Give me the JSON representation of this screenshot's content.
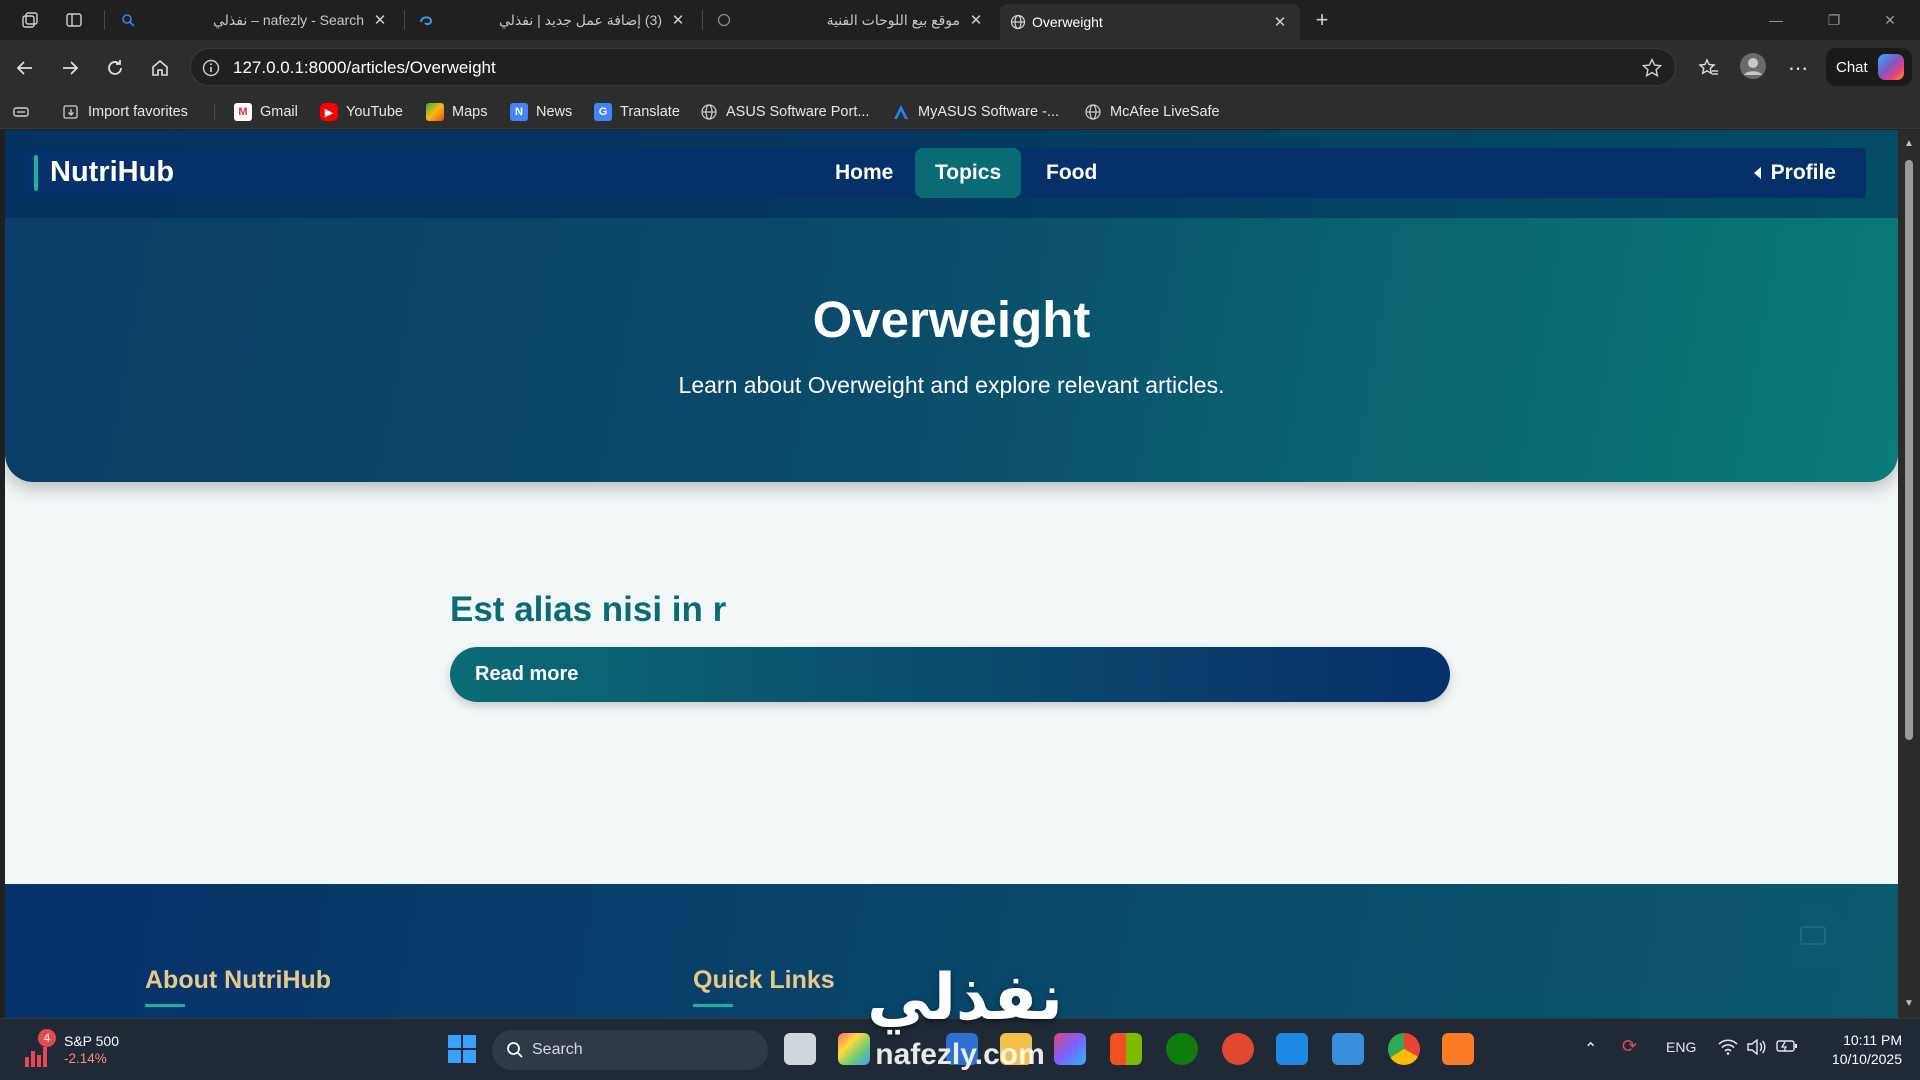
{
  "browser": {
    "tabs": [
      {
        "title": "nafezly - Search – نفذلي",
        "active": false
      },
      {
        "title": "(3) إضافة عمل جديد | نفذلي",
        "active": false
      },
      {
        "title": "موقع بيع اللوحات الفنية",
        "active": false
      },
      {
        "title": "Overweight",
        "active": true
      }
    ],
    "url": "127.0.0.1:8000/articles/Overweight",
    "chat_label": "Chat",
    "bookmarks": [
      "Import favorites",
      "Gmail",
      "YouTube",
      "Maps",
      "News",
      "Translate",
      "ASUS Software Port...",
      "MyASUS Software -...",
      "McAfee LiveSafe"
    ]
  },
  "site": {
    "brand": "NutriHub",
    "nav": [
      {
        "label": "Home",
        "active": false
      },
      {
        "label": "Topics",
        "active": true
      },
      {
        "label": "Food",
        "active": false
      }
    ],
    "profile_label": "Profile",
    "hero": {
      "title": "Overweight",
      "subtitle": "Learn about Overweight and explore relevant articles."
    },
    "articles": [
      {
        "title": "Est alias nisi in r",
        "button": "Read more"
      }
    ],
    "footer": {
      "about_heading": "About NutriHub",
      "links_heading": "Quick Links"
    }
  },
  "watermark": {
    "arabic": "نفذلي",
    "latin": "nafezly.com"
  },
  "taskbar": {
    "stock": {
      "name": "S&P 500",
      "change": "-2.14%",
      "badge": "4"
    },
    "search_label": "Search",
    "language": "ENG",
    "time": "10:11 PM",
    "date": "10/10/2025"
  },
  "colors": {
    "brand_teal": "#0b6b74",
    "brand_navy": "#06306a",
    "footer_heading": "#e8c98a",
    "accent": "#18b3a3"
  }
}
